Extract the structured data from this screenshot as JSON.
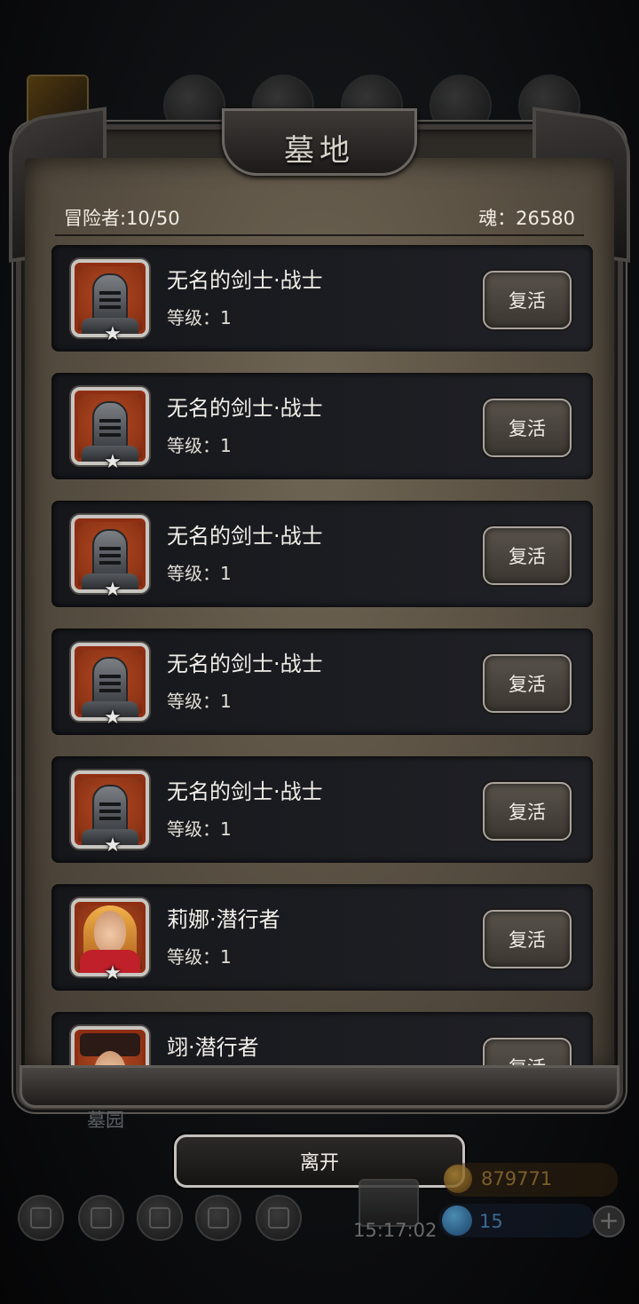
{
  "window": {
    "title": "墓地",
    "adventurers_label": "冒险者:10/50",
    "souls_label": "魂：26580"
  },
  "heroes": [
    {
      "name": "无名的剑士·战士",
      "level": "等级：1",
      "revive": "复活",
      "portrait": "armored-knight"
    },
    {
      "name": "无名的剑士·战士",
      "level": "等级：1",
      "revive": "复活",
      "portrait": "armored-knight"
    },
    {
      "name": "无名的剑士·战士",
      "level": "等级：1",
      "revive": "复活",
      "portrait": "armored-knight"
    },
    {
      "name": "无名的剑士·战士",
      "level": "等级：1",
      "revive": "复活",
      "portrait": "armored-knight"
    },
    {
      "name": "无名的剑士·战士",
      "level": "等级：1",
      "revive": "复活",
      "portrait": "armored-knight"
    },
    {
      "name": "莉娜·潜行者",
      "level": "等级：1",
      "revive": "复活",
      "portrait": "blonde-rogue"
    },
    {
      "name": "翊·潜行者",
      "level": "",
      "revive": "复活",
      "portrait": "hooded-rogue"
    }
  ],
  "footer": {
    "location_label": "墓园",
    "leave_button": "离开",
    "gold_amount": "879771",
    "gem_amount": "15",
    "clock": "15:17:02"
  },
  "colors": {
    "panel": "#5b5244",
    "card": "#1c1d22",
    "portrait_frame": "#8f2e12",
    "frame_metal": "#3d3a37"
  }
}
